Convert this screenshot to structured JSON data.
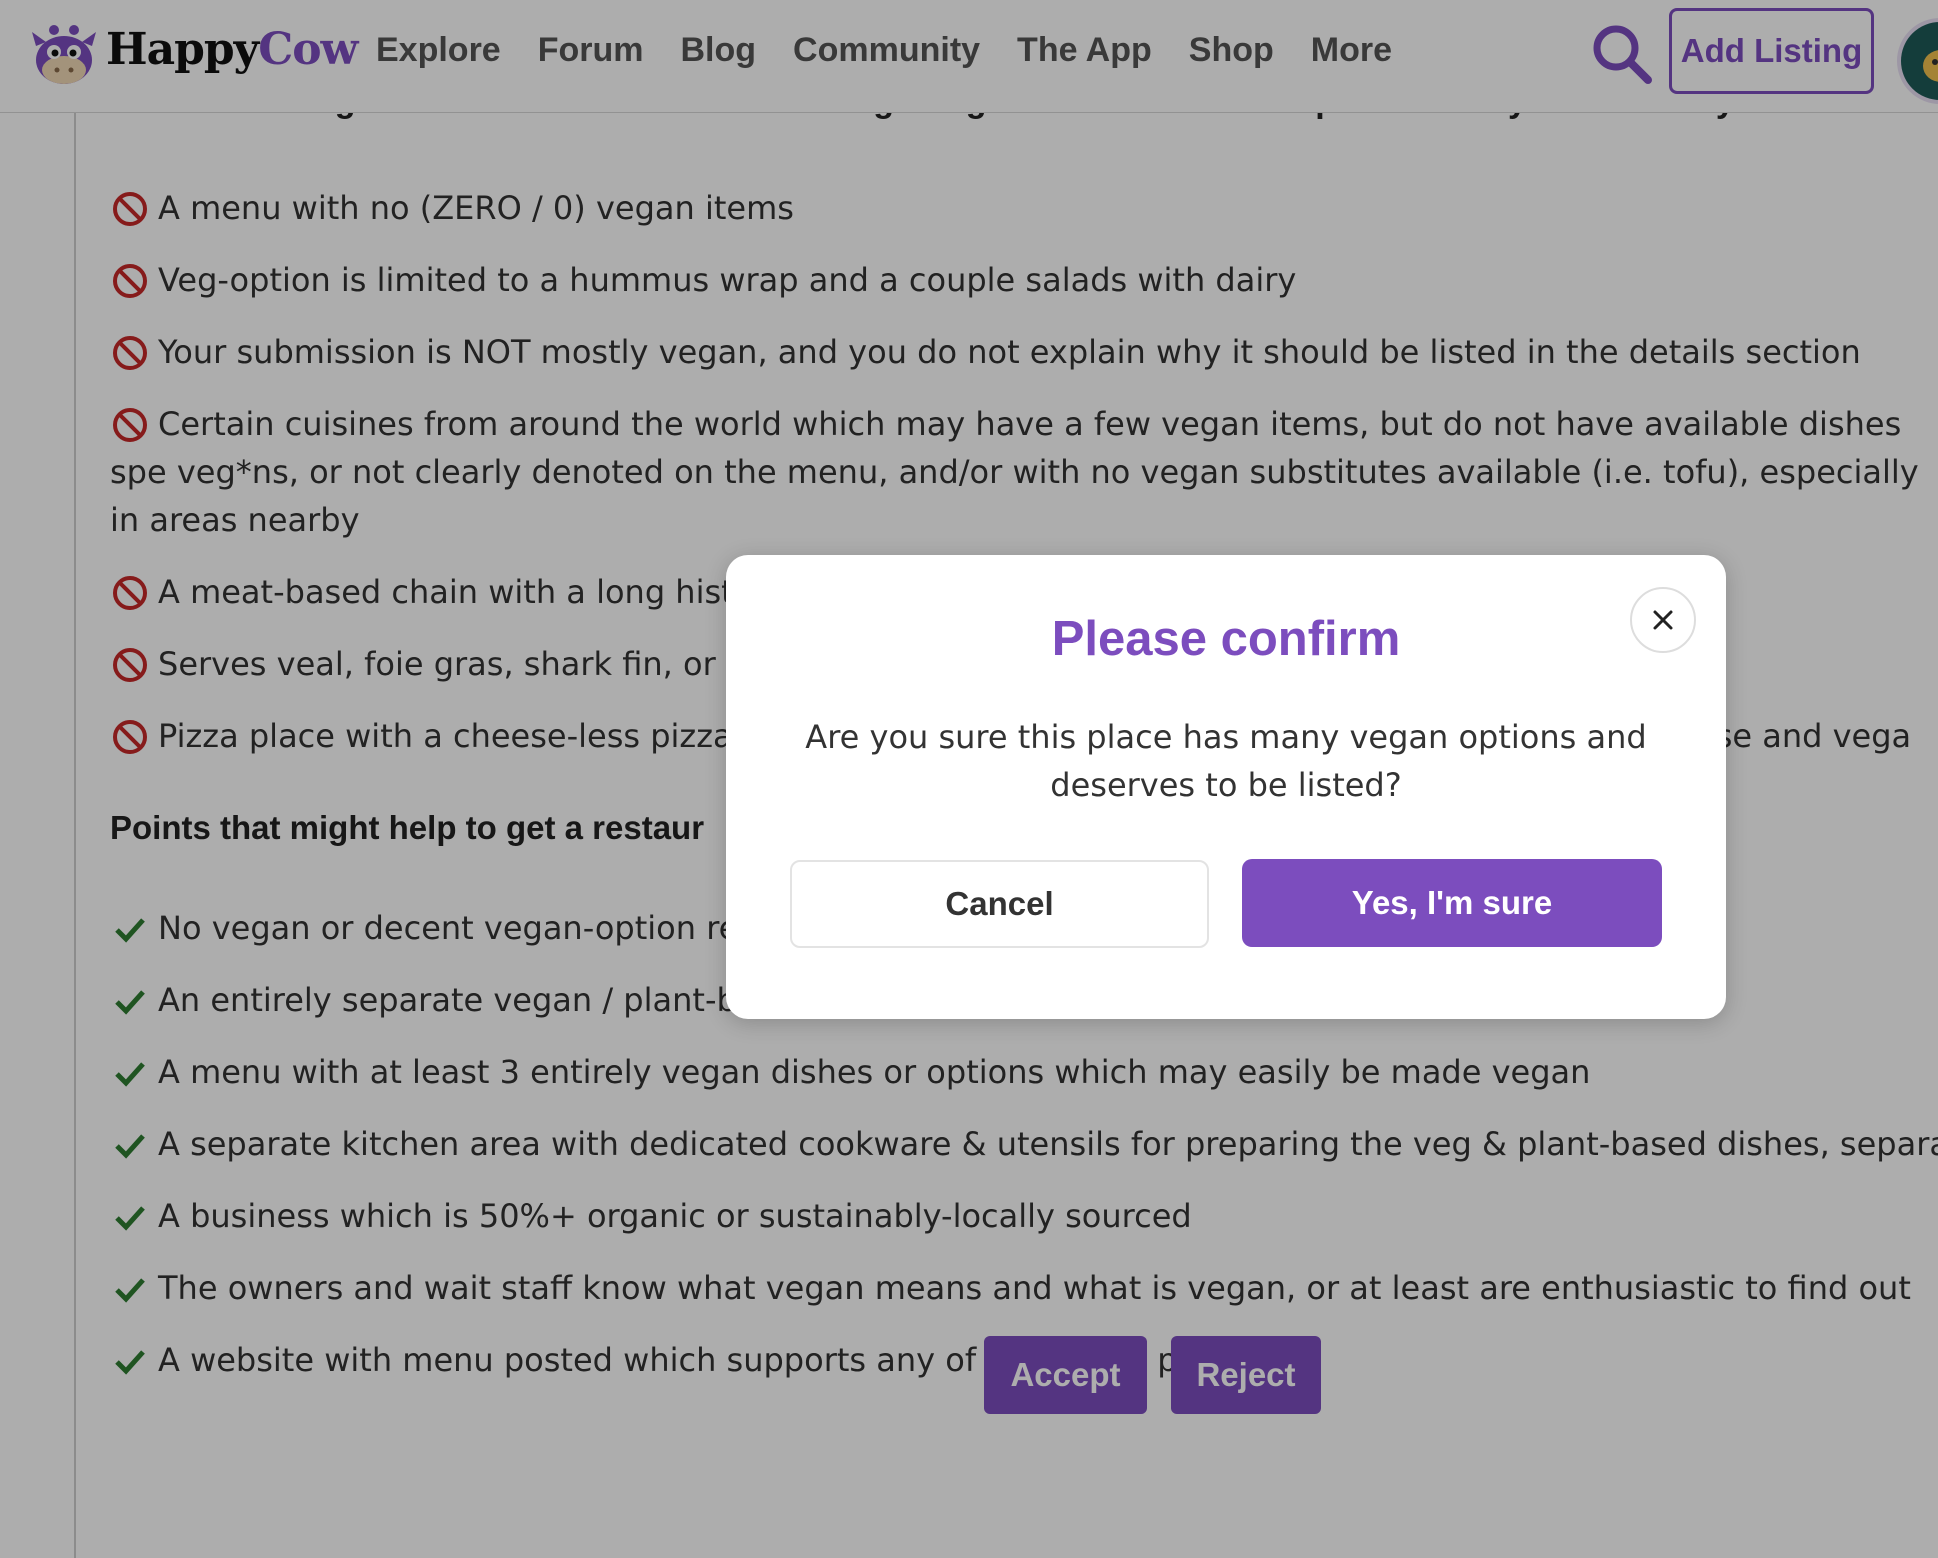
{
  "header": {
    "brand_part1": "Happy",
    "brand_part2": "Cow",
    "nav": [
      "Explore",
      "Forum",
      "Blog",
      "Community",
      "The App",
      "Shop",
      "More"
    ],
    "add_listing": "Add Listing"
  },
  "content": {
    "cut_heading": "Points that might block a meat restaurant from getting listed when better option already exist nearby:",
    "block_items": [
      "A menu with no (ZERO / 0) vegan items",
      "Veg-option is limited to a hummus wrap and a couple salads with dairy",
      "Your submission is NOT mostly vegan, and you do not explain why it should be listed in the details section",
      "Certain cuisines from around the world which may have a few vegan items, but do not have available dishes spe veg*ns, or not clearly denoted on the menu, and/or with no vegan substitutes available (i.e. tofu), especially in areas nearby",
      "A meat-based chain with a long hist",
      "Serves veal, foie gras, shark fin, or ot",
      "Pizza place with a cheese-less pizza"
    ],
    "block_item_tail": "ese and vega",
    "help_heading": "Points that might help to get a restaur",
    "help_items": [
      "No vegan or decent vegan-option re",
      "An entirely separate vegan / plant-b",
      "A menu with at least 3 entirely vegan dishes or options which may easily be made vegan",
      "A separate kitchen area with dedicated cookware & utensils for preparing the veg & plant-based dishes, separat",
      "A business which is 50%+ organic or sustainably-locally sourced",
      "The owners and wait staff know what vegan means and what is vegan, or at least are enthusiastic to find out",
      "A website with menu posted which supports any of the above points"
    ],
    "accept": "Accept",
    "reject": "Reject"
  },
  "modal": {
    "title": "Please confirm",
    "body": "Are you sure this place has many vegan options and deserves to be listed?",
    "cancel": "Cancel",
    "confirm": "Yes, I'm sure"
  },
  "colors": {
    "brand_purple": "#7c4dbe",
    "block_red": "#c62828",
    "check_green": "#2e7d32"
  }
}
